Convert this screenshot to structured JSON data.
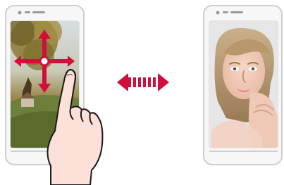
{
  "scene": {
    "description_visible_text": "",
    "left_phone": {
      "screen": "landscape-photo",
      "gesture": "drag-with-one-finger"
    },
    "right_phone": {
      "screen": "portrait-photo"
    },
    "transition": "swipe-between-images"
  },
  "icons": {
    "left_phone_gesture_arrows": "four-way-arrows-icon",
    "transition_arrow": "double-arrow-icon",
    "finger": "pointing-finger-icon"
  },
  "colors": {
    "phone_body": "#f7f7f7",
    "phone_outline": "#cfcfcf",
    "arrow_red": "#d10f3c",
    "skin": "#fde1d8",
    "sky": "#b8c7d6",
    "grass": "#8b7a2f",
    "portrait_bg": "#e8e8e8"
  }
}
